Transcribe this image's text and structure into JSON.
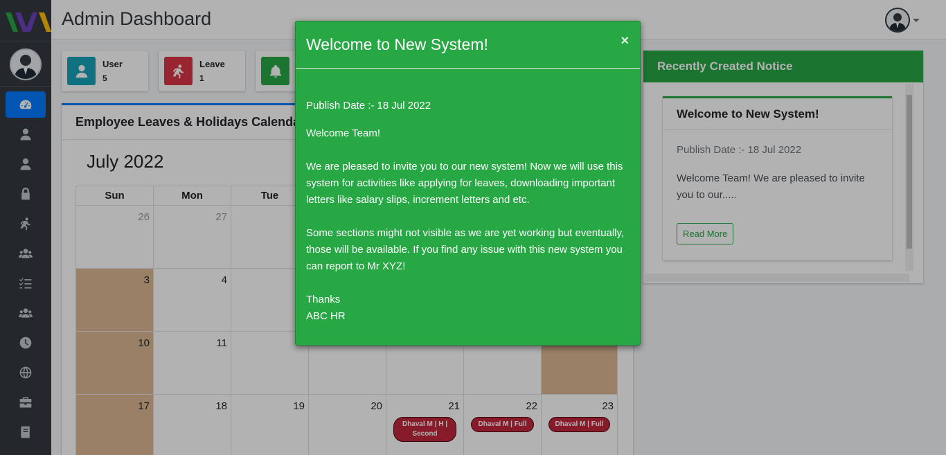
{
  "header": {
    "title": "Admin Dashboard"
  },
  "sidebar": {
    "icons": [
      "dashboard-icon",
      "user-icon",
      "user-tie-icon",
      "lock-icon",
      "running-icon",
      "users-icon",
      "tasks-icon",
      "user-group-icon",
      "clock-icon",
      "globe-icon",
      "briefcase-icon",
      "book-icon"
    ]
  },
  "info_boxes": [
    {
      "label": "User",
      "count": "5",
      "color": "#17a2b8",
      "icon": "user-icon"
    },
    {
      "label": "Leave",
      "count": "1",
      "color": "#dc3545",
      "icon": "running-icon"
    },
    {
      "label": "",
      "count": "",
      "color": "#28a745",
      "icon": "bell-icon"
    }
  ],
  "calendar": {
    "card_title": "Employee Leaves & Holidays Calendar",
    "month_label": "July 2022",
    "weekdays": [
      "Sun",
      "Mon",
      "Tue",
      "",
      "",
      "",
      ""
    ],
    "rows": [
      [
        {
          "day": "26",
          "other": true
        },
        {
          "day": "27",
          "other": true
        },
        {
          "day": ""
        },
        {
          "day": ""
        },
        {
          "day": ""
        },
        {
          "day": ""
        },
        {
          "day": ""
        }
      ],
      [
        {
          "day": "3",
          "weekend": true
        },
        {
          "day": "4"
        },
        {
          "day": ""
        },
        {
          "day": ""
        },
        {
          "day": ""
        },
        {
          "day": ""
        },
        {
          "day": ""
        }
      ],
      [
        {
          "day": "10",
          "weekend": true
        },
        {
          "day": "11"
        },
        {
          "day": ""
        },
        {
          "day": ""
        },
        {
          "day": ""
        },
        {
          "day": ""
        },
        {
          "day": "",
          "weekend": true
        }
      ],
      [
        {
          "day": "17",
          "weekend": true
        },
        {
          "day": "18"
        },
        {
          "day": "19"
        },
        {
          "day": "20"
        },
        {
          "day": "21",
          "event": "Dhaval M | H | Second"
        },
        {
          "day": "22",
          "event": "Dhaval M | Full"
        },
        {
          "day": "23",
          "event": "Dhaval M | Full"
        }
      ]
    ]
  },
  "notice": {
    "panel_title": "Recently Created Notice",
    "title": "Welcome to New System!",
    "publish_date": "Publish Date :- 18 Jul 2022",
    "excerpt": "Welcome Team! We are pleased to invite you to our.....",
    "read_more_label": "Read More"
  },
  "modal": {
    "title": "Welcome to New System!",
    "close_label": "×",
    "publish_date": "Publish Date :- 18 Jul 2022",
    "greeting": "Welcome Team!",
    "paragraph1": "We are pleased to invite you to our new system! Now we will use this system for activities like applying for leaves, downloading important letters like salary slips, increment letters and etc.",
    "paragraph2": "Some sections might not visible as we are yet working but eventually, those will be available. If you find any issue with this new system you can report to Mr XYZ!",
    "signoff": "Thanks",
    "signature": "ABC HR",
    "color": "#28a745"
  }
}
